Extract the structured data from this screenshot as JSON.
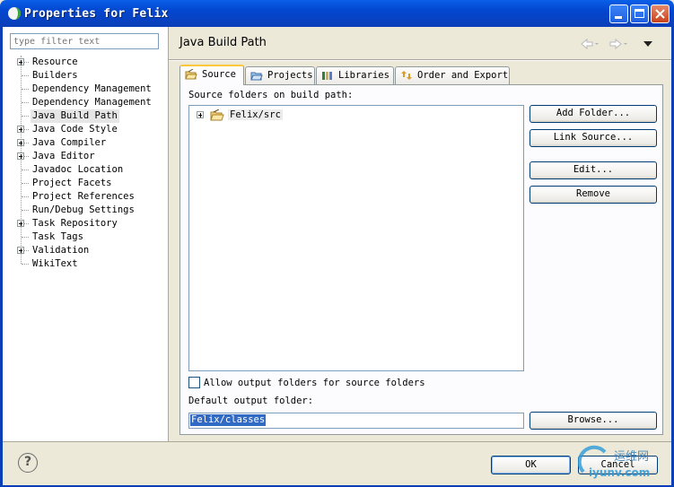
{
  "window": {
    "title": "Properties for Felix"
  },
  "filter": {
    "placeholder": "type filter text"
  },
  "tree": [
    {
      "label": "Resource",
      "expandable": true
    },
    {
      "label": "Builders",
      "expandable": false
    },
    {
      "label": "Dependency Management",
      "expandable": false
    },
    {
      "label": "Dependency Management",
      "expandable": false
    },
    {
      "label": "Java Build Path",
      "expandable": false,
      "selected": true
    },
    {
      "label": "Java Code Style",
      "expandable": true
    },
    {
      "label": "Java Compiler",
      "expandable": true
    },
    {
      "label": "Java Editor",
      "expandable": true
    },
    {
      "label": "Javadoc Location",
      "expandable": false
    },
    {
      "label": "Project Facets",
      "expandable": false
    },
    {
      "label": "Project References",
      "expandable": false
    },
    {
      "label": "Run/Debug Settings",
      "expandable": false
    },
    {
      "label": "Task Repository",
      "expandable": true
    },
    {
      "label": "Task Tags",
      "expandable": false
    },
    {
      "label": "Validation",
      "expandable": true
    },
    {
      "label": "WikiText",
      "expandable": false
    }
  ],
  "page": {
    "title": "Java Build Path",
    "tabs": [
      "Source",
      "Projects",
      "Libraries",
      "Order and Export"
    ],
    "active_tab": "Source",
    "source_label": "Source folders on build path:",
    "source_folders": [
      {
        "label": "Felix/src"
      }
    ],
    "buttons": {
      "add_folder": "Add Folder...",
      "link_source": "Link Source...",
      "edit": "Edit...",
      "remove": "Remove",
      "browse": "Browse..."
    },
    "allow_output_label": "Allow output folders for source folders",
    "allow_output_checked": false,
    "default_output_label": "Default output folder:",
    "default_output_value": "Felix/classes"
  },
  "dialog": {
    "ok": "OK",
    "cancel": "Cancel",
    "help": "?"
  },
  "watermark": {
    "line1": "运维网",
    "line2": "iyunv.com"
  },
  "colors": {
    "titlebar": "#0346cf",
    "selection": "#316ac5",
    "tab_accent": "#ffc83c"
  }
}
